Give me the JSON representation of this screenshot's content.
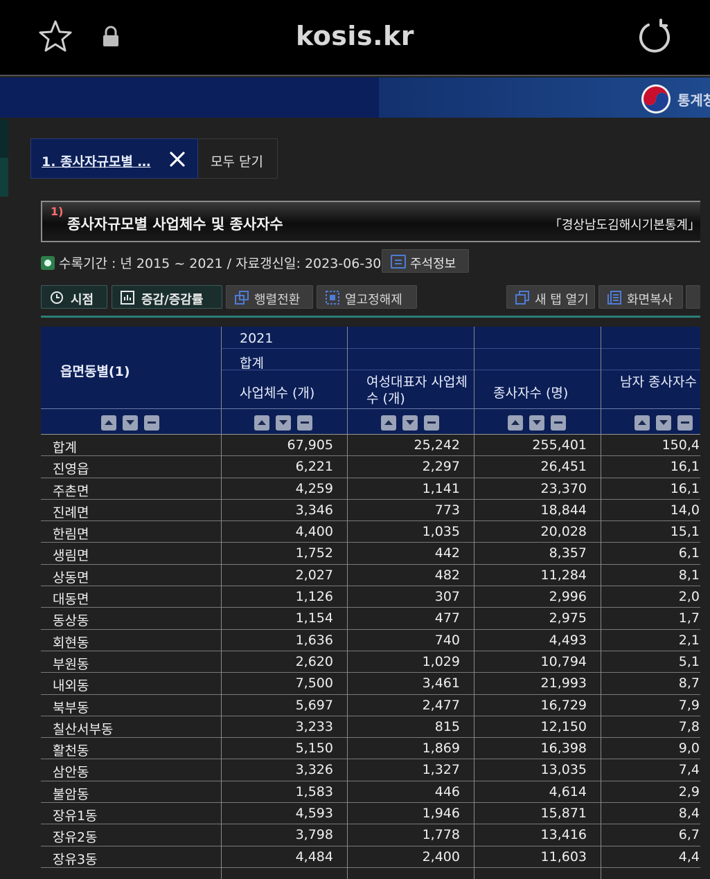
{
  "browser": {
    "url": "kosis.kr"
  },
  "banner": {
    "org_text": "통계청"
  },
  "tabs": {
    "active_label": "1. 종사자규모별 …",
    "close_all_label": "모두 닫기"
  },
  "table_title": {
    "footnote": "1)",
    "title": "종사자규모별 사업체수 및 종사자수",
    "source": "「경상남도김해시기본통계」"
  },
  "meta": {
    "period": "수록기간 : 년 2015 ~ 2021 / 자료갱신일: 2023-06-30 /",
    "note_button": "주석정보"
  },
  "toolbar": {
    "time_label": "시점",
    "change_label": "증감/증감률",
    "pivot_label": "행렬전환",
    "unfix_label": "열고정해제",
    "new_tab_label": "새 탭 열기",
    "copy_label": "화면복사"
  },
  "grid": {
    "row_header": "읍면동별(1)",
    "year": "2021",
    "group": "합계",
    "columns": [
      "사업체수 (개)",
      "여성대표자 사업체수 (개)",
      "종사자수 (명)",
      "남자 종사자수 (명)"
    ],
    "rows": [
      {
        "name": "합계",
        "v": [
          "67,905",
          "25,242",
          "255,401",
          "150,4"
        ]
      },
      {
        "name": "진영읍",
        "v": [
          "6,221",
          "2,297",
          "26,451",
          "16,1"
        ]
      },
      {
        "name": "주촌면",
        "v": [
          "4,259",
          "1,141",
          "23,370",
          "16,1"
        ]
      },
      {
        "name": "진례면",
        "v": [
          "3,346",
          "773",
          "18,844",
          "14,0"
        ]
      },
      {
        "name": "한림면",
        "v": [
          "4,400",
          "1,035",
          "20,028",
          "15,1"
        ]
      },
      {
        "name": "생림면",
        "v": [
          "1,752",
          "442",
          "8,357",
          "6,1"
        ]
      },
      {
        "name": "상동면",
        "v": [
          "2,027",
          "482",
          "11,284",
          "8,1"
        ]
      },
      {
        "name": "대동면",
        "v": [
          "1,126",
          "307",
          "2,996",
          "2,0"
        ]
      },
      {
        "name": "동상동",
        "v": [
          "1,154",
          "477",
          "2,975",
          "1,7"
        ]
      },
      {
        "name": "회현동",
        "v": [
          "1,636",
          "740",
          "4,493",
          "2,1"
        ]
      },
      {
        "name": "부원동",
        "v": [
          "2,620",
          "1,029",
          "10,794",
          "5,1"
        ]
      },
      {
        "name": "내외동",
        "v": [
          "7,500",
          "3,461",
          "21,993",
          "8,7"
        ]
      },
      {
        "name": "북부동",
        "v": [
          "5,697",
          "2,477",
          "16,729",
          "7,9"
        ]
      },
      {
        "name": "칠산서부동",
        "v": [
          "3,233",
          "815",
          "12,150",
          "7,8"
        ]
      },
      {
        "name": "활천동",
        "v": [
          "5,150",
          "1,869",
          "16,398",
          "9,0"
        ]
      },
      {
        "name": "삼안동",
        "v": [
          "3,326",
          "1,327",
          "13,035",
          "7,4"
        ]
      },
      {
        "name": "불암동",
        "v": [
          "1,583",
          "446",
          "4,614",
          "2,9"
        ]
      },
      {
        "name": "장유1동",
        "v": [
          "4,593",
          "1,946",
          "15,871",
          "8,4"
        ]
      },
      {
        "name": "장유2동",
        "v": [
          "3,798",
          "1,778",
          "13,416",
          "6,7"
        ]
      },
      {
        "name": "장유3동",
        "v": [
          "4,484",
          "2,400",
          "11,603",
          "4,4"
        ]
      }
    ]
  }
}
